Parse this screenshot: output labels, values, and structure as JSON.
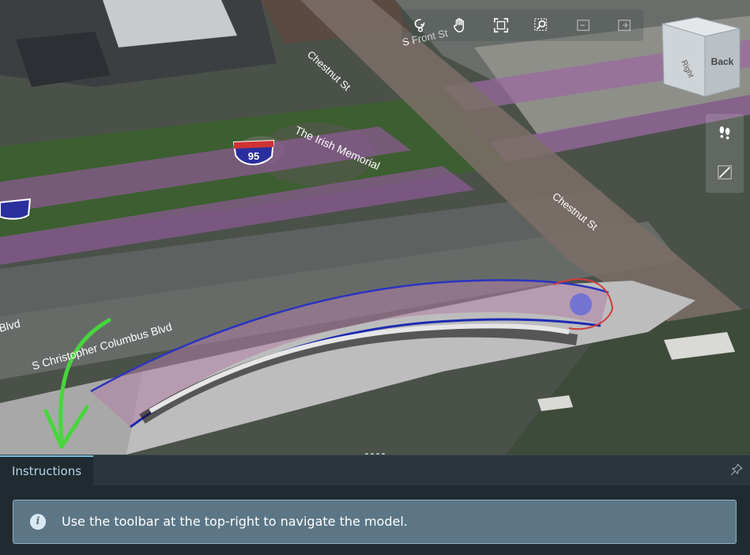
{
  "map": {
    "street_labels": [
      "Chestnut St",
      "Chestnut St",
      "S Front St",
      "S Christopher Columbus Blvd",
      "Blvd",
      "The Irish Memorial"
    ],
    "highway_shield": "95"
  },
  "toolbar": {
    "tools": [
      {
        "icon": "orbit-icon",
        "label": "Orbit"
      },
      {
        "icon": "pan-hand-icon",
        "label": "Pan"
      },
      {
        "icon": "fit-view-icon",
        "label": "Fit to view"
      },
      {
        "icon": "zoom-window-icon",
        "label": "Zoom window"
      },
      {
        "icon": "split-left-icon",
        "label": ""
      },
      {
        "icon": "split-right-icon",
        "label": ""
      }
    ]
  },
  "viewcube": {
    "front_face": "Back",
    "side_face": "Right"
  },
  "side_tools": [
    {
      "icon": "footprints-icon"
    },
    {
      "icon": "measure-line-icon"
    }
  ],
  "panel": {
    "tab_label": "Instructions",
    "info_message": "Use the toolbar at the top-right to navigate the model."
  },
  "colors": {
    "panel_bg": "#1f2b31",
    "tab_accent": "#77b9dc",
    "message_bg": "#5c7686",
    "annotation_arrow": "#47d63d"
  }
}
